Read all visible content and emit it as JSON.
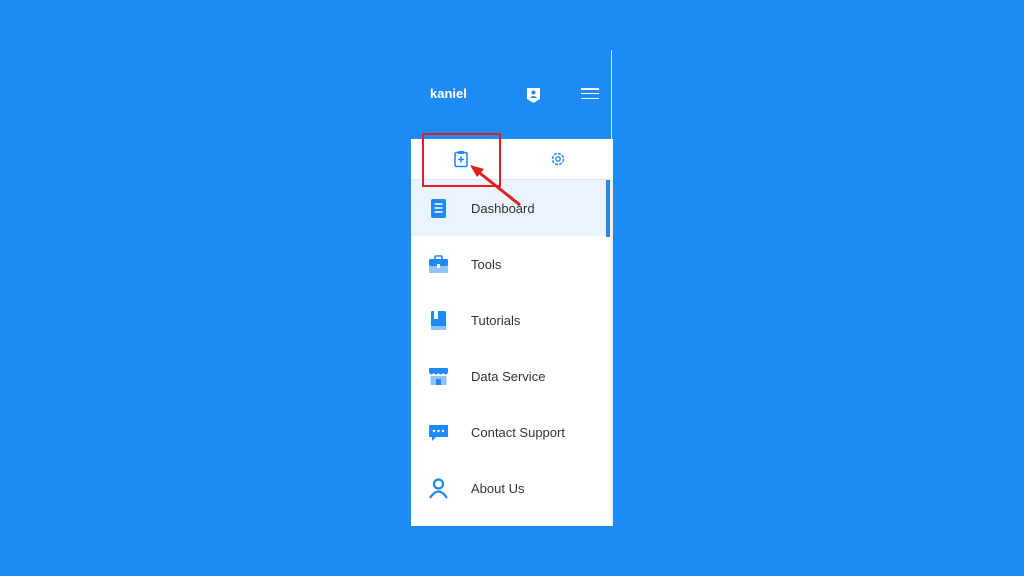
{
  "header": {
    "username": "kaniel",
    "icons": [
      "user-badge-icon",
      "hamburger-menu-icon"
    ]
  },
  "tabs": [
    {
      "icon": "clipboard-plus-icon",
      "selected": true
    },
    {
      "icon": "gear-icon",
      "selected": false
    }
  ],
  "menu": {
    "items": [
      {
        "label": "Dashboard",
        "icon": "document-icon",
        "active": true
      },
      {
        "label": "Tools",
        "icon": "toolbox-icon"
      },
      {
        "label": "Tutorials",
        "icon": "book-icon"
      },
      {
        "label": "Data Service",
        "icon": "storefront-icon"
      },
      {
        "label": "Contact Support",
        "icon": "chat-bubble-icon"
      },
      {
        "label": "About Us",
        "icon": "person-icon"
      }
    ]
  },
  "colors": {
    "background": "#1e8af5",
    "accent": "#1e8af5",
    "highlight": "#e01f1f",
    "active_row": "#eaf3fe"
  }
}
